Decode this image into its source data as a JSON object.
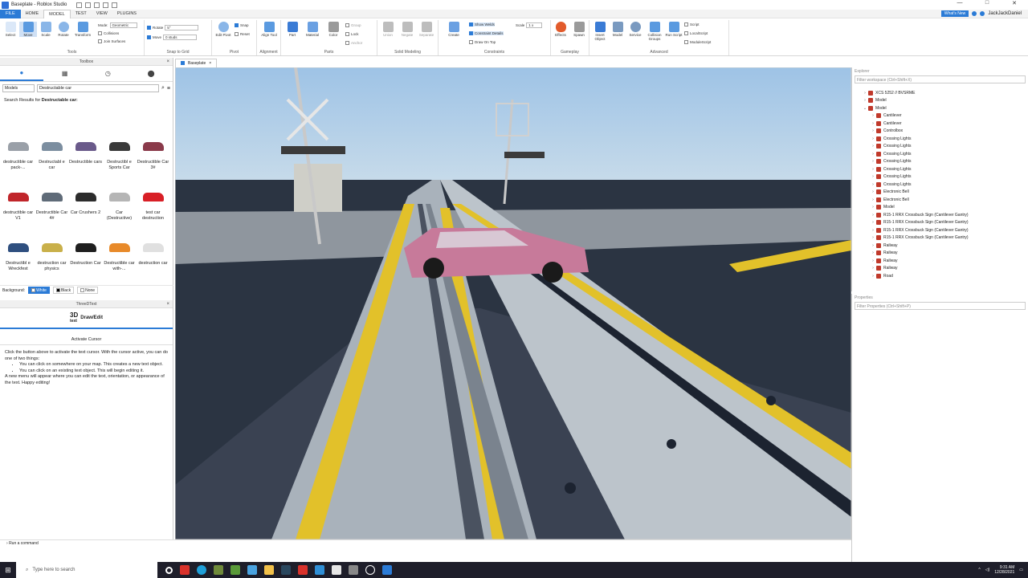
{
  "window": {
    "title": "Baseplate - Roblox Studio",
    "controls": [
      "—",
      "□",
      "✕"
    ]
  },
  "menu": {
    "file": "FILE",
    "tabs": [
      "HOME",
      "MODEL",
      "TEST",
      "VIEW",
      "PLUGINS"
    ],
    "active_tab": "MODEL",
    "whats_new": "What's New",
    "user": "JackJackDaniel"
  },
  "ribbon": {
    "tools": {
      "label": "Tools",
      "buttons": [
        "Select",
        "Move",
        "Scale",
        "Rotate",
        "Transform"
      ],
      "mode_label": "Mode:",
      "mode_value": "Geometric",
      "collisions": "Collisions",
      "join_surfaces": "Join Surfaces"
    },
    "snap": {
      "label": "Snap to Grid",
      "rotate": "Rotate",
      "rotate_value": "5°",
      "move": "Move",
      "move_value": "0 studs"
    },
    "pivot": {
      "label": "Pivot",
      "edit_pivot": "Edit Pivot",
      "snap": "Snap",
      "reset": "Reset"
    },
    "alignment": {
      "label": "Alignment",
      "align_tool": "Align Tool"
    },
    "parts": {
      "label": "Parts",
      "buttons": [
        "Part",
        "Material",
        "Color"
      ],
      "group": "Group",
      "lock": "Lock",
      "anchor": "Anchor"
    },
    "solid": {
      "label": "Solid Modeling",
      "buttons": [
        "Union",
        "Negate",
        "Separate"
      ]
    },
    "constraints": {
      "label": "Constraints",
      "create": "Create",
      "show_welds": "Show Welds",
      "constraint_details": "Constraint Details",
      "draw_on_top": "Draw On Top",
      "scale_label": "Scale",
      "scale_value": "1 x"
    },
    "gameplay": {
      "label": "Gameplay",
      "buttons": [
        "Effects",
        "Spawn"
      ]
    },
    "advanced": {
      "label": "Advanced",
      "buttons": [
        "Insert Object",
        "Model",
        "Service",
        "Collision Groups",
        "Run Script"
      ],
      "script": "Script",
      "local_script": "LocalScript",
      "module_script": "ModuleScript"
    }
  },
  "toolbox": {
    "title": "Toolbox",
    "category": "Models",
    "search": "Destructable car",
    "results_prefix": "Search Results for",
    "results_query": "Destructable car:",
    "items": [
      {
        "label": "destructible car pack-...",
        "color": "#9aa0a8"
      },
      {
        "label": "Destructabl e car",
        "color": "#7c8ea0"
      },
      {
        "label": "Destructible cars",
        "color": "#6a5a8a"
      },
      {
        "label": "Destructibl e Sports Car",
        "color": "#3a3a3a"
      },
      {
        "label": "Destructible Car 3#",
        "color": "#8a3a4a"
      },
      {
        "label": "destructible car V1",
        "color": "#c0252a"
      },
      {
        "label": "Destructible Car 4#",
        "color": "#5f6b78"
      },
      {
        "label": "Car Crushers 2",
        "color": "#2c2c2c"
      },
      {
        "label": "Car (Destructive)",
        "color": "#b5b5b5"
      },
      {
        "label": "test car destruction",
        "color": "#d81f26"
      },
      {
        "label": "Destructibl e Wreckfest",
        "color": "#2f4f7f"
      },
      {
        "label": "destruction car physics",
        "color": "#c9b04a"
      },
      {
        "label": "Destruction Car",
        "color": "#1f1f1f"
      },
      {
        "label": "Destructible car with-...",
        "color": "#e88a2a"
      },
      {
        "label": "destruction car",
        "color": "#e0e0e0"
      }
    ],
    "background_label": "Background:",
    "background_options": [
      "White",
      "Black",
      "None"
    ]
  },
  "draw_edit": {
    "title": "ThreeDText",
    "logo": "3D",
    "logo_sub": "text",
    "heading": "Draw/Edit",
    "activate": "Activate Cursor",
    "intro": "Click the button above to activate the text cursor. With the cursor active, you can do one of two things:",
    "bullet1": "You can click on somewhere on your map. This creates a new text object.",
    "bullet2": "You can click on an existing text object. This will begin editing it.",
    "outro": "A new menu will appear where you can edit the text, orientation, or appearance of the text. Happy editing!"
  },
  "viewport_tab": "Baseplate",
  "explorer": {
    "title": "Explorer",
    "filter": "Filter workspace (Ctrl+Shift+X)",
    "nodes": [
      {
        "label": "XCS 5252 // BVSRME",
        "depth": 1,
        "arrow": "›"
      },
      {
        "label": "Model",
        "depth": 1,
        "arrow": "›"
      },
      {
        "label": "Model",
        "depth": 1,
        "arrow": "⌄"
      },
      {
        "label": "Cantilever",
        "depth": 2,
        "arrow": "›"
      },
      {
        "label": "Cantilever",
        "depth": 2,
        "arrow": "›"
      },
      {
        "label": "Controlbox",
        "depth": 2,
        "arrow": "›"
      },
      {
        "label": "Crossing Lights",
        "depth": 2,
        "arrow": "›"
      },
      {
        "label": "Crossing Lights",
        "depth": 2,
        "arrow": "›"
      },
      {
        "label": "Crossing Lights",
        "depth": 2,
        "arrow": "›"
      },
      {
        "label": "Crossing Lights",
        "depth": 2,
        "arrow": "›"
      },
      {
        "label": "Crossing Lights",
        "depth": 2,
        "arrow": "›"
      },
      {
        "label": "Crossing Lights",
        "depth": 2,
        "arrow": "›"
      },
      {
        "label": "Crossing Lights",
        "depth": 2,
        "arrow": "›"
      },
      {
        "label": "Electronic Bell",
        "depth": 2,
        "arrow": "›"
      },
      {
        "label": "Electronic Bell",
        "depth": 2,
        "arrow": "›"
      },
      {
        "label": "Model",
        "depth": 2,
        "arrow": "›"
      },
      {
        "label": "R15-1 RRX Crossbuck Sign (Cantilever Gantry)",
        "depth": 2,
        "arrow": "›"
      },
      {
        "label": "R15-1 RRX Crossbuck Sign (Cantilever Gantry)",
        "depth": 2,
        "arrow": "›"
      },
      {
        "label": "R15-1 RRX Crossbuck Sign (Cantilever Gantry)",
        "depth": 2,
        "arrow": "›"
      },
      {
        "label": "R15-1 RRX Crossbuck Sign (Cantilever Gantry)",
        "depth": 2,
        "arrow": "›"
      },
      {
        "label": "Railway",
        "depth": 2,
        "arrow": "›"
      },
      {
        "label": "Railway",
        "depth": 2,
        "arrow": "›"
      },
      {
        "label": "Railway",
        "depth": 2,
        "arrow": "›"
      },
      {
        "label": "Railway",
        "depth": 2,
        "arrow": "›"
      },
      {
        "label": "Road",
        "depth": 2,
        "arrow": "›"
      }
    ]
  },
  "properties": {
    "title": "Properties",
    "filter": "Filter Properties (Ctrl+Shift+P)"
  },
  "command_bar": "Run a command",
  "taskbar": {
    "search": "Type here to search",
    "time": "9:31 AM",
    "date": "12/28/2021"
  }
}
